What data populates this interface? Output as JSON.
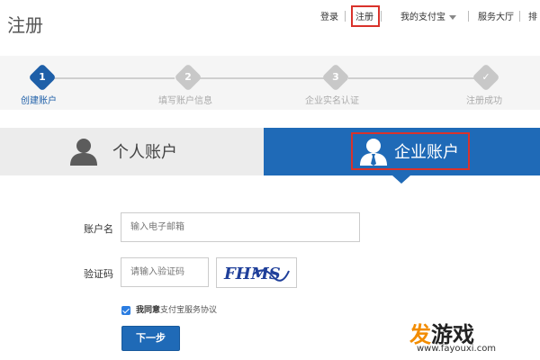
{
  "header": {
    "title": "注册",
    "nav": {
      "login": "登录",
      "register": "注册",
      "my_alipay": "我的支付宝",
      "service_hall": "服务大厅",
      "truncated": "排"
    }
  },
  "steps": [
    {
      "number": "1",
      "label": "创建账户",
      "state": "active"
    },
    {
      "number": "2",
      "label": "填写账户信息",
      "state": "pending"
    },
    {
      "number": "3",
      "label": "企业实名认证",
      "state": "pending"
    },
    {
      "number": "✓",
      "label": "注册成功",
      "state": "pending"
    }
  ],
  "tabs": {
    "personal": "个人账户",
    "enterprise": "企业账户"
  },
  "form": {
    "account_label": "账户名",
    "account_placeholder": "输入电子邮箱",
    "captcha_label": "验证码",
    "captcha_placeholder": "请输入验证码",
    "captcha_text": "FHMS",
    "agree_text": "我同意",
    "agree_link": "支付宝服务协议",
    "next_button": "下一步"
  },
  "watermark": {
    "first_char": "发",
    "rest": "游戏",
    "url": "www.fayouxi.com"
  },
  "colors": {
    "primary_blue": "#1f6ab7",
    "active_step": "#1e5fa8",
    "pending_step": "#c8c8c8",
    "highlight_red": "#d9322b",
    "watermark_orange": "#f28c00"
  }
}
